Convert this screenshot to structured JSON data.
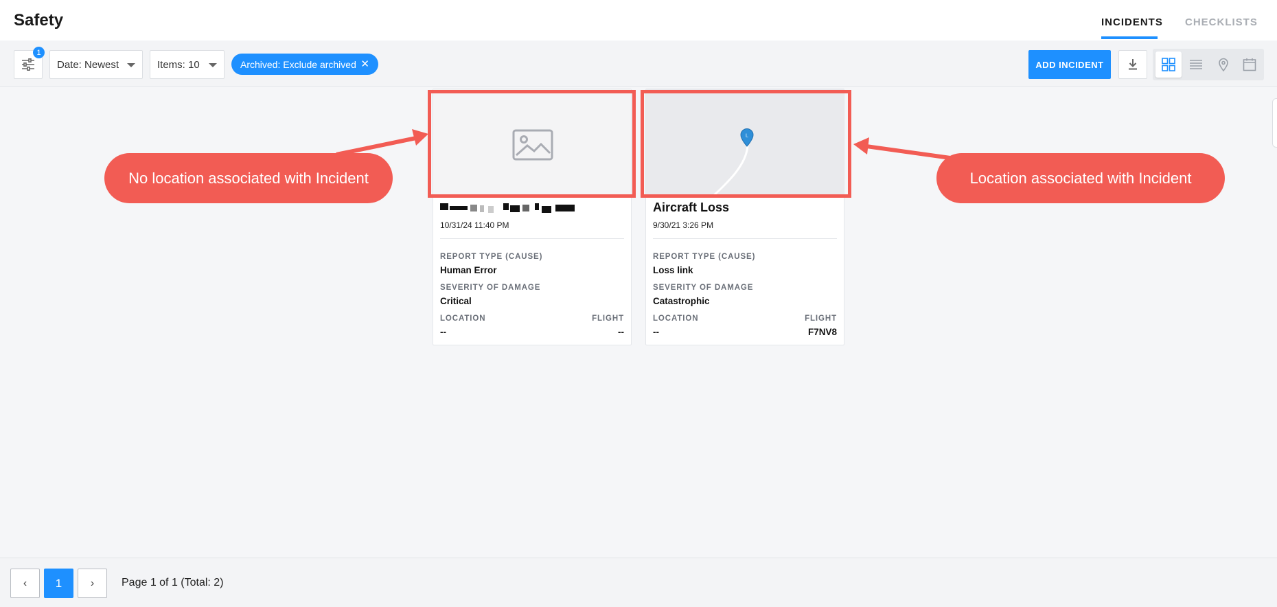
{
  "header": {
    "title": "Safety",
    "tabs": [
      {
        "label": "INCIDENTS",
        "active": true
      },
      {
        "label": "CHECKLISTS",
        "active": false
      }
    ]
  },
  "toolbar": {
    "filter_badge": "1",
    "date_select": "Date: Newest",
    "items_select": "Items: 10",
    "chip_label": "Archived: Exclude archived",
    "chip_close": "✕",
    "add_button": "ADD INCIDENT",
    "views": [
      "grid-view-icon",
      "list-view-icon",
      "map-view-icon",
      "calendar-view-icon"
    ],
    "active_view": "grid-view-icon"
  },
  "cards": [
    {
      "title": "",
      "title_redacted": true,
      "date": "10/31/24 11:40 PM",
      "media": "image-placeholder-icon",
      "report_type_label": "REPORT TYPE (CAUSE)",
      "report_type": "Human Error",
      "severity_label": "SEVERITY OF DAMAGE",
      "severity": "Critical",
      "location_label": "LOCATION",
      "location": "--",
      "flight_label": "FLIGHT",
      "flight": "--"
    },
    {
      "title": "Aircraft Loss",
      "date": "9/30/21 3:26 PM",
      "media": "map-pin-icon",
      "pin_letter": "L",
      "report_type_label": "REPORT TYPE (CAUSE)",
      "report_type": "Loss link",
      "severity_label": "SEVERITY OF DAMAGE",
      "severity": "Catastrophic",
      "location_label": "LOCATION",
      "location": "--",
      "flight_label": "FLIGHT",
      "flight": "F7NV8"
    }
  ],
  "annotations": {
    "left": "No location associated with Incident",
    "right": "Location associated with Incident",
    "color": "#f25c54"
  },
  "pagination": {
    "prev": "‹",
    "current": "1",
    "next": "›",
    "text": "Page 1 of 1 (Total: 2)"
  },
  "colors": {
    "accent": "#1e90ff",
    "annotation": "#f25c54"
  }
}
